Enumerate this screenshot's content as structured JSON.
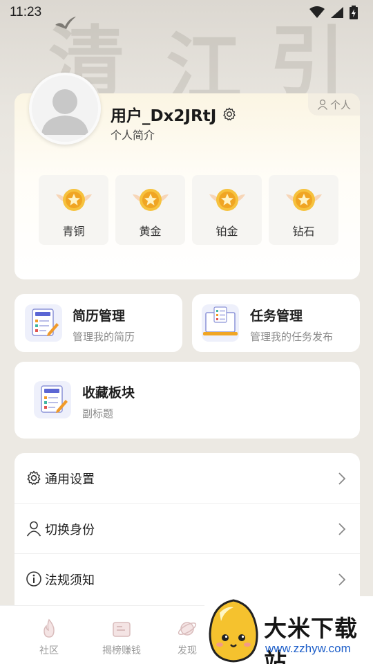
{
  "status_bar": {
    "time": "11:23"
  },
  "profile": {
    "username": "用户_Dx2JRtJ",
    "bio": "个人简介",
    "tag": "个人",
    "levels": [
      {
        "label": "青铜"
      },
      {
        "label": "黄金"
      },
      {
        "label": "铂金"
      },
      {
        "label": "钻石"
      }
    ]
  },
  "features": {
    "resume": {
      "title": "简历管理",
      "subtitle": "管理我的简历"
    },
    "task": {
      "title": "任务管理",
      "subtitle": "管理我的任务发布"
    },
    "favorites": {
      "title": "收藏板块",
      "subtitle": "副标题"
    }
  },
  "settings": {
    "items": [
      {
        "label": "通用设置",
        "icon": "gear-icon"
      },
      {
        "label": "切换身份",
        "icon": "person-icon"
      },
      {
        "label": "法规须知",
        "icon": "info-icon"
      }
    ]
  },
  "nav": {
    "items": [
      {
        "label": "社区",
        "icon": "flame-icon"
      },
      {
        "label": "揭榜赚钱",
        "icon": "ticket-icon"
      },
      {
        "label": "发现",
        "icon": "planet-icon"
      }
    ]
  },
  "watermark": {
    "title": "大米下载站",
    "url": "www.zzhyw.com"
  },
  "colors": {
    "medal": "#f5b62e",
    "accent_blue": "#1e5fc9"
  }
}
